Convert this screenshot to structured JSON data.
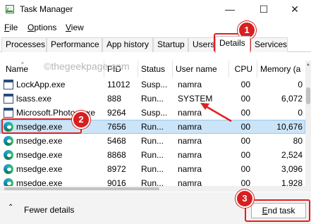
{
  "window": {
    "title": "Task Manager",
    "controls": {
      "minimize": "—",
      "maximize": "☐",
      "close": "✕"
    }
  },
  "menu": {
    "items": [
      {
        "access": "F",
        "rest": "ile"
      },
      {
        "access": "O",
        "rest": "ptions"
      },
      {
        "access": "V",
        "rest": "iew"
      }
    ]
  },
  "tabs": [
    "Processes",
    "Performance",
    "App history",
    "Startup",
    "Users",
    "Details",
    "Services"
  ],
  "active_tab": "Details",
  "watermark": "©thegeekpage.com",
  "columns": [
    "Name",
    "PID",
    "Status",
    "User name",
    "CPU",
    "Memory (a"
  ],
  "rows": [
    {
      "name": "LockApp.exe",
      "pid": "11012",
      "status": "Susp...",
      "user": "namra",
      "cpu": "00",
      "memory": "0",
      "icon": "window-icon",
      "selected": false
    },
    {
      "name": "lsass.exe",
      "pid": "888",
      "status": "Run...",
      "user": "SYSTEM",
      "cpu": "00",
      "memory": "6,072",
      "icon": "window-icon",
      "selected": false
    },
    {
      "name": "Microsoft.Photos.exe",
      "pid": "9264",
      "status": "Susp...",
      "user": "namra",
      "cpu": "00",
      "memory": "0",
      "icon": "window-icon",
      "selected": false
    },
    {
      "name": "msedge.exe",
      "pid": "7656",
      "status": "Run...",
      "user": "namra",
      "cpu": "00",
      "memory": "10,676",
      "icon": "edge-icon",
      "selected": true
    },
    {
      "name": "msedge.exe",
      "pid": "5468",
      "status": "Run...",
      "user": "namra",
      "cpu": "00",
      "memory": "80",
      "icon": "edge-icon",
      "selected": false
    },
    {
      "name": "msedge.exe",
      "pid": "8868",
      "status": "Run...",
      "user": "namra",
      "cpu": "00",
      "memory": "2,524",
      "icon": "edge-icon",
      "selected": false
    },
    {
      "name": "msedge.exe",
      "pid": "8972",
      "status": "Run...",
      "user": "namra",
      "cpu": "00",
      "memory": "3,096",
      "icon": "edge-icon",
      "selected": false
    },
    {
      "name": "msedge.exe",
      "pid": "9016",
      "status": "Run...",
      "user": "namra",
      "cpu": "00",
      "memory": "1,928",
      "icon": "edge-icon",
      "selected": false
    }
  ],
  "footer": {
    "fewer_details": "Fewer details",
    "end_task": {
      "access": "E",
      "rest": "nd task"
    }
  },
  "annotations": {
    "badges": [
      "1",
      "2",
      "3"
    ],
    "highlight_color": "#e02020"
  },
  "colors": {
    "selection": "#cce4f7",
    "annotation": "#d81f1f"
  }
}
